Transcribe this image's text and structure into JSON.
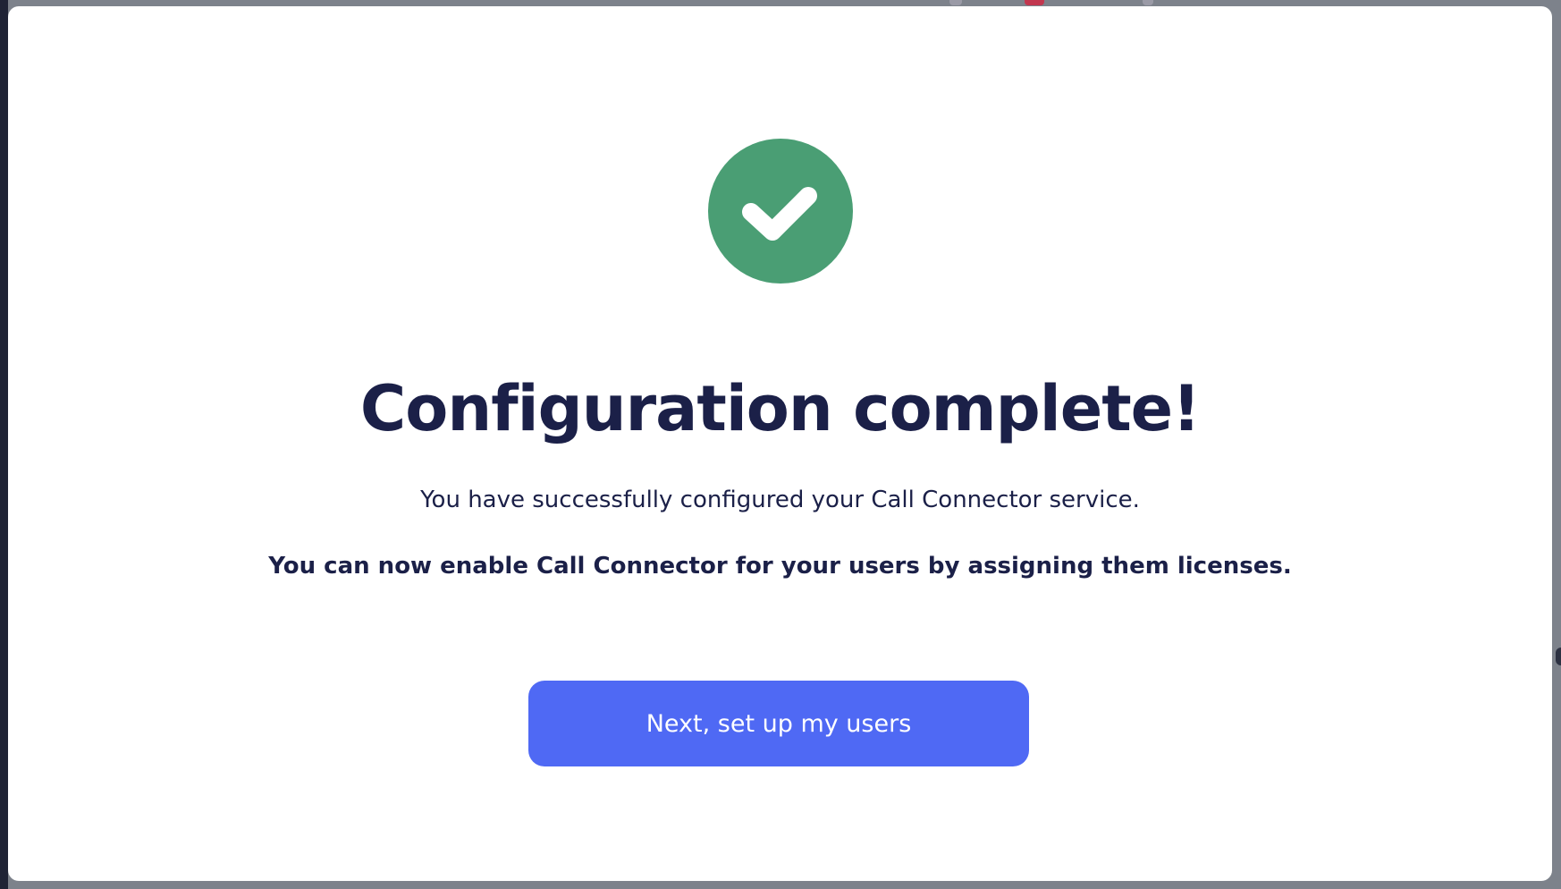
{
  "colors": {
    "success_green": "#4a9e74",
    "primary_blue": "#4f69f4",
    "heading_navy": "#1b2048",
    "surface": "#ffffff"
  },
  "success_icon": {
    "icon": "check-circle-icon"
  },
  "dialog": {
    "title": "Configuration complete!",
    "message": "You have successfully configured your Call Connector service.",
    "instruction": "You can now enable Call Connector for your users by assigning them licenses.",
    "next_button_label": "Next, set up my users"
  }
}
